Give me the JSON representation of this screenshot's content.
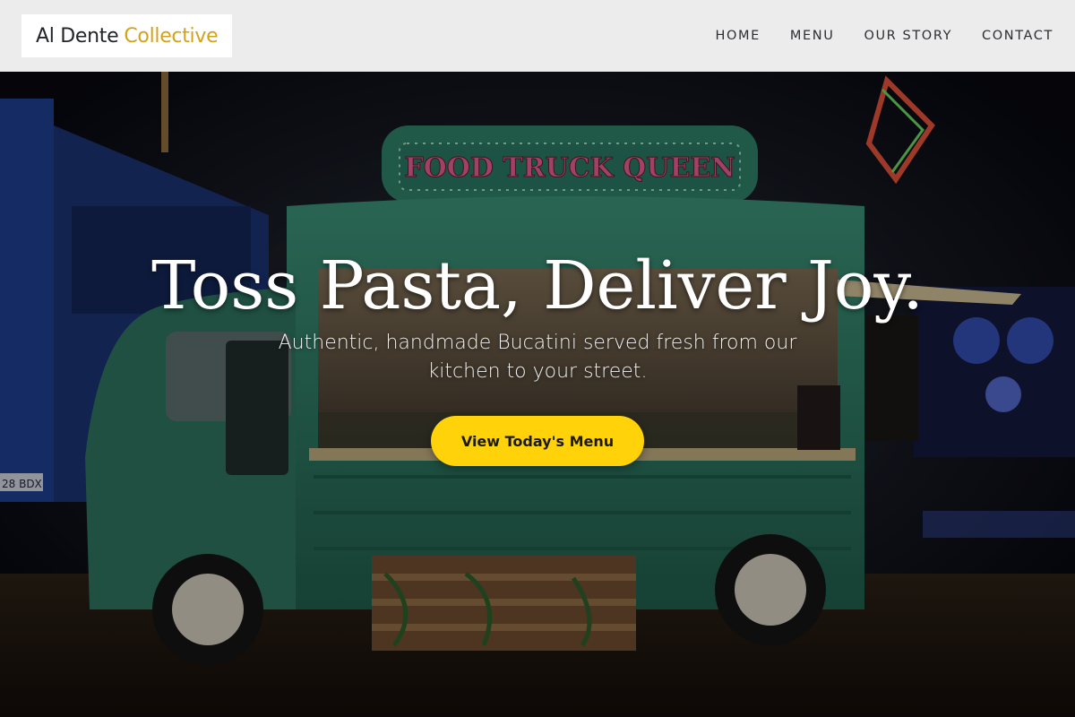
{
  "brand": {
    "name_part1": "Al Dente",
    "name_part2": "Collective"
  },
  "nav": {
    "items": [
      {
        "label": "HOME"
      },
      {
        "label": "MENU"
      },
      {
        "label": "OUR STORY"
      },
      {
        "label": "CONTACT"
      }
    ]
  },
  "hero": {
    "title": "Toss Pasta, Deliver Joy.",
    "subtitle": "Authentic, handmade Bucatini served fresh from our kitchen to your street.",
    "cta_label": "View Today's Menu",
    "truck_sign": "FOOD TRUCK QUEEN",
    "plate_text": "28 BDX"
  },
  "colors": {
    "accent_brand": "#d4a21a",
    "cta": "#ffd20a",
    "truck": "#2f7a64",
    "header_bg": "#ececec"
  }
}
